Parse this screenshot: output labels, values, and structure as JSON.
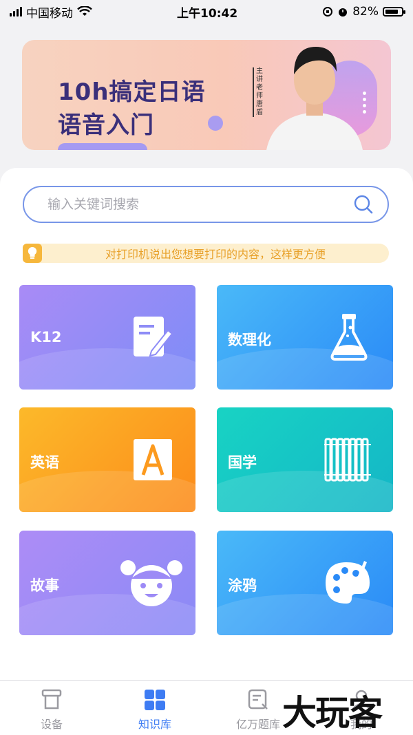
{
  "status_bar": {
    "carrier": "中国移动",
    "time": "上午10:42",
    "battery_percent": "82%",
    "battery_level": 0.82
  },
  "banner": {
    "title": "10h搞定日语\n语音入门",
    "teacher_tag": "主讲老师 唐盾"
  },
  "search": {
    "placeholder": "输入关键词搜索"
  },
  "tip": {
    "text": "对打印机说出您想要打印的内容，这样更方便"
  },
  "categories": [
    {
      "label": "K12",
      "icon": "notepad-pencil-icon"
    },
    {
      "label": "数理化",
      "icon": "flask-icon"
    },
    {
      "label": "英语",
      "icon": "letter-a-icon"
    },
    {
      "label": "国学",
      "icon": "bamboo-scroll-icon"
    },
    {
      "label": "故事",
      "icon": "child-face-icon"
    },
    {
      "label": "涂鸦",
      "icon": "palette-icon"
    }
  ],
  "tabbar": {
    "items": [
      {
        "label": "设备",
        "icon": "printer-icon",
        "active": false
      },
      {
        "label": "知识库",
        "icon": "grid-icon",
        "active": true
      },
      {
        "label": "亿万题库",
        "icon": "question-bank-icon",
        "active": false
      },
      {
        "label": "我的",
        "icon": "profile-icon",
        "active": false
      }
    ],
    "active_color": "#3e7cf3",
    "inactive_color": "#9a9aa0"
  },
  "watermark": "大玩客"
}
